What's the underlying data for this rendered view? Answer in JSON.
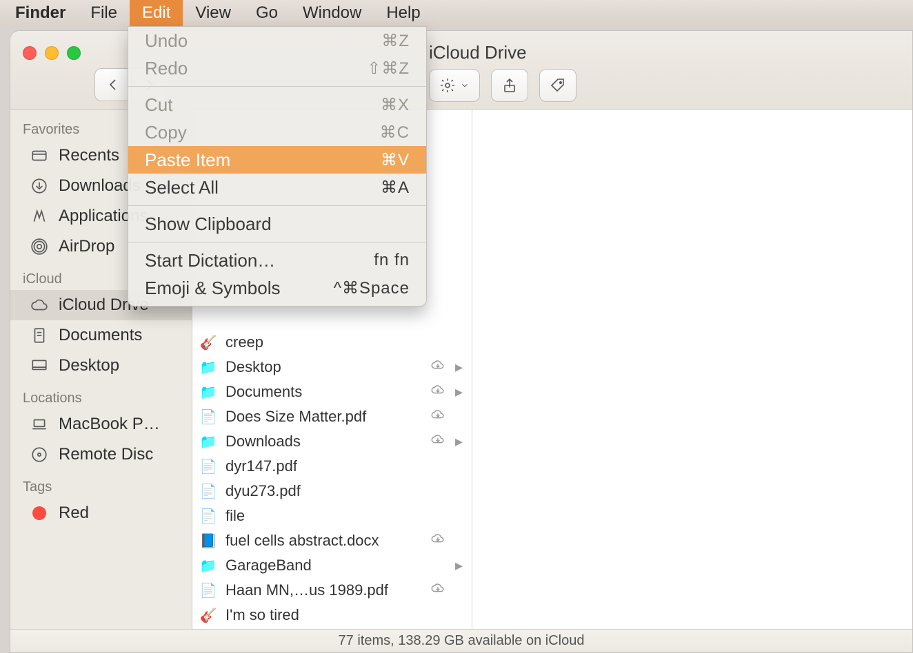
{
  "menubar": {
    "app": "Finder",
    "items": [
      "File",
      "Edit",
      "View",
      "Go",
      "Window",
      "Help"
    ],
    "active_index": 1
  },
  "window": {
    "title": "iCloud Drive"
  },
  "dropdown": {
    "groups": [
      [
        {
          "label": "Undo",
          "shortcut": "⌘Z",
          "disabled": true
        },
        {
          "label": "Redo",
          "shortcut": "⇧⌘Z",
          "disabled": true
        }
      ],
      [
        {
          "label": "Cut",
          "shortcut": "⌘X",
          "disabled": true
        },
        {
          "label": "Copy",
          "shortcut": "⌘C",
          "disabled": true
        },
        {
          "label": "Paste Item",
          "shortcut": "⌘V",
          "highlight": true
        },
        {
          "label": "Select All",
          "shortcut": "⌘A"
        }
      ],
      [
        {
          "label": "Show Clipboard",
          "shortcut": ""
        }
      ],
      [
        {
          "label": "Start Dictation…",
          "shortcut": "fn fn"
        },
        {
          "label": "Emoji & Symbols",
          "shortcut": "^⌘Space"
        }
      ]
    ]
  },
  "sidebar": {
    "sections": [
      {
        "title": "Favorites",
        "items": [
          {
            "icon": "recents",
            "label": "Recents"
          },
          {
            "icon": "downloads",
            "label": "Downloads"
          },
          {
            "icon": "applications",
            "label": "Applications"
          },
          {
            "icon": "airdrop",
            "label": "AirDrop"
          }
        ]
      },
      {
        "title": "iCloud",
        "items": [
          {
            "icon": "icloud",
            "label": "iCloud Drive",
            "selected": true
          },
          {
            "icon": "documents",
            "label": "Documents"
          },
          {
            "icon": "desktop",
            "label": "Desktop"
          }
        ]
      },
      {
        "title": "Locations",
        "items": [
          {
            "icon": "laptop",
            "label": "MacBook P…"
          },
          {
            "icon": "disc",
            "label": "Remote Disc"
          }
        ]
      },
      {
        "title": "Tags",
        "items": [
          {
            "icon": "tag",
            "label": "Red",
            "color": "#ff4b3e"
          }
        ]
      }
    ]
  },
  "files": [
    {
      "icon": "gb",
      "name": "creep",
      "cloud": false,
      "folder": false
    },
    {
      "icon": "folder",
      "name": "Desktop",
      "cloud": true,
      "folder": true
    },
    {
      "icon": "folder",
      "name": "Documents",
      "cloud": true,
      "folder": true
    },
    {
      "icon": "pdf",
      "name": "Does Size Matter.pdf",
      "cloud": true,
      "folder": false
    },
    {
      "icon": "folder",
      "name": "Downloads",
      "cloud": true,
      "folder": true
    },
    {
      "icon": "pdf",
      "name": "dyr147.pdf",
      "cloud": false,
      "folder": false
    },
    {
      "icon": "pdf",
      "name": "dyu273.pdf",
      "cloud": false,
      "folder": false
    },
    {
      "icon": "blank",
      "name": "file",
      "cloud": false,
      "folder": false
    },
    {
      "icon": "docx",
      "name": "fuel cells abstract.docx",
      "cloud": true,
      "folder": false
    },
    {
      "icon": "folder",
      "name": "GarageBand",
      "cloud": false,
      "folder": true
    },
    {
      "icon": "pdf",
      "name": "Haan MN,…us 1989.pdf",
      "cloud": true,
      "folder": false
    },
    {
      "icon": "gb",
      "name": "I'm so tired",
      "cloud": false,
      "folder": false
    }
  ],
  "status": {
    "item_count": "77 items",
    "storage": "138.29 GB available on iCloud"
  }
}
